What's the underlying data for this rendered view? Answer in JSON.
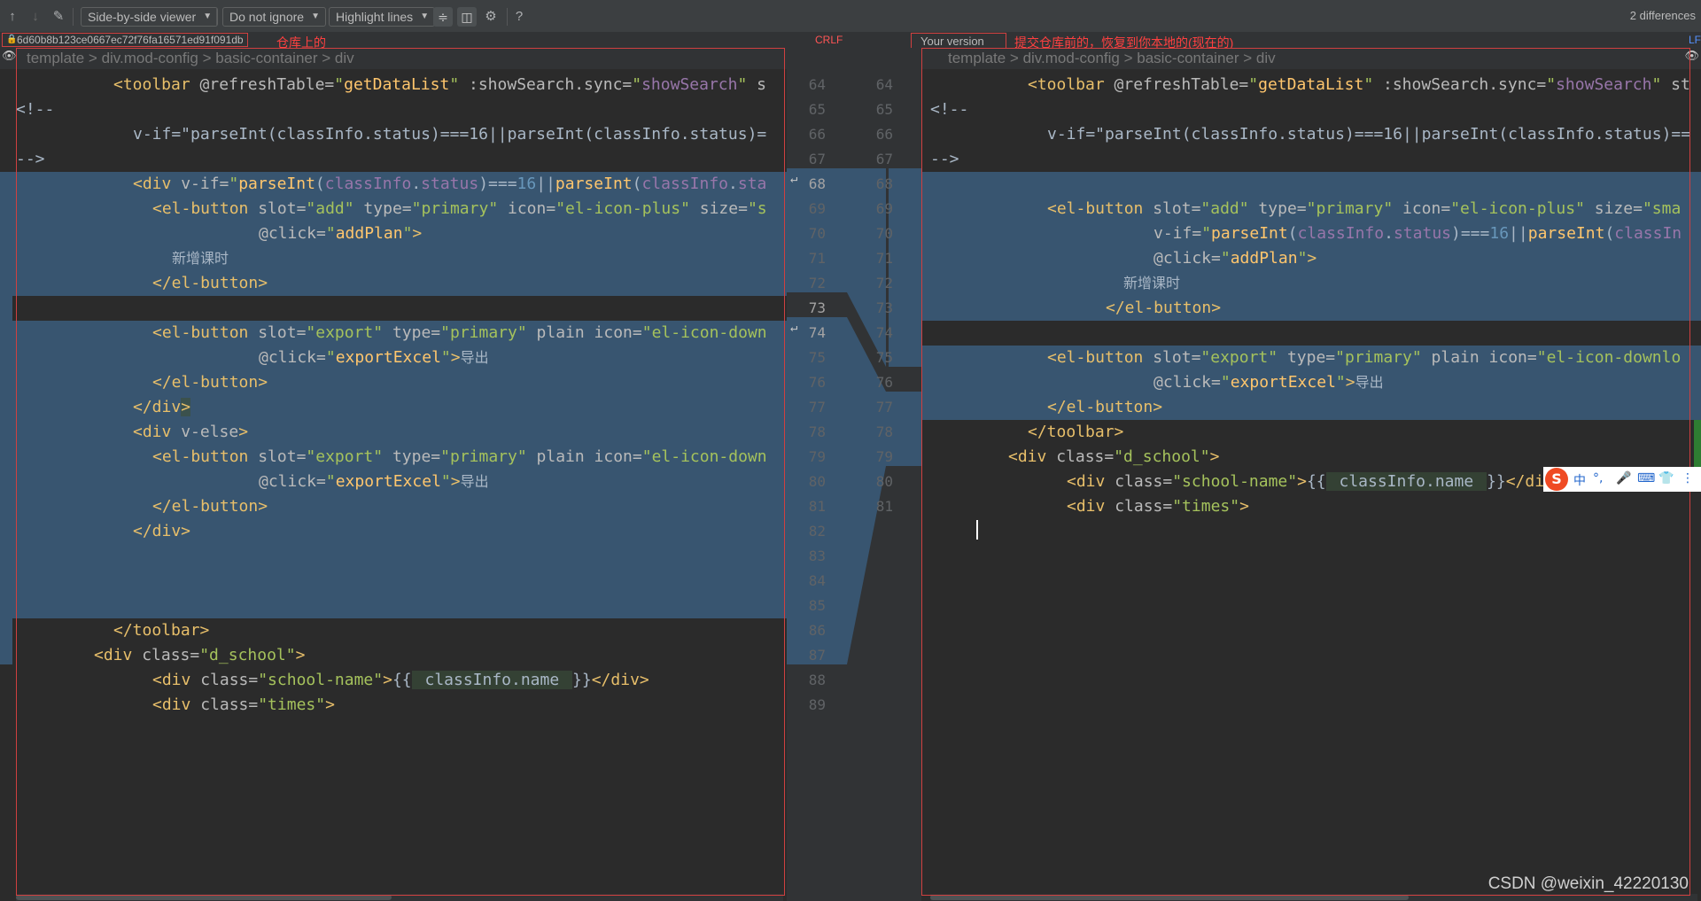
{
  "toolbar": {
    "viewer_mode": "Side-by-side viewer",
    "whitespace": "Do not ignore",
    "highlight": "Highlight lines",
    "help": "?",
    "differences": "2 differences"
  },
  "header": {
    "left_revision": "6d60b8b123ce0667ec72f76fa16571ed91f091db",
    "left_note": "仓库上的",
    "crlf": "CRLF",
    "right_title": "Your version",
    "right_note": "提交仓库前的，恢复到你本地的(现在的)",
    "lf": "LF"
  },
  "breadcrumb": "template > div.mod-config > basic-container > div",
  "left_gutter_numbers": [
    "64",
    "65",
    "66",
    "67",
    "68",
    "69",
    "70",
    "71",
    "72",
    "73",
    "74",
    "75",
    "76",
    "77",
    "78",
    "79",
    "80",
    "81",
    "82",
    "83",
    "84",
    "85",
    "86",
    "87",
    "88",
    "89"
  ],
  "right_gutter_numbers": [
    "64",
    "65",
    "66",
    "67",
    "68",
    "69",
    "70",
    "71",
    "72",
    "73",
    "74",
    "75",
    "76",
    "77",
    "78",
    "79",
    "80",
    "81"
  ],
  "watermark": "CSDN @weixin_42220130",
  "ime": {
    "logo": "S",
    "items": [
      "中",
      "°,",
      "🎤",
      "⌨",
      "👕",
      "⋮"
    ]
  },
  "colors": {
    "changed_bg": "#385570",
    "editor_bg": "#2b2b2b",
    "annotation_red": "#ff4040"
  }
}
